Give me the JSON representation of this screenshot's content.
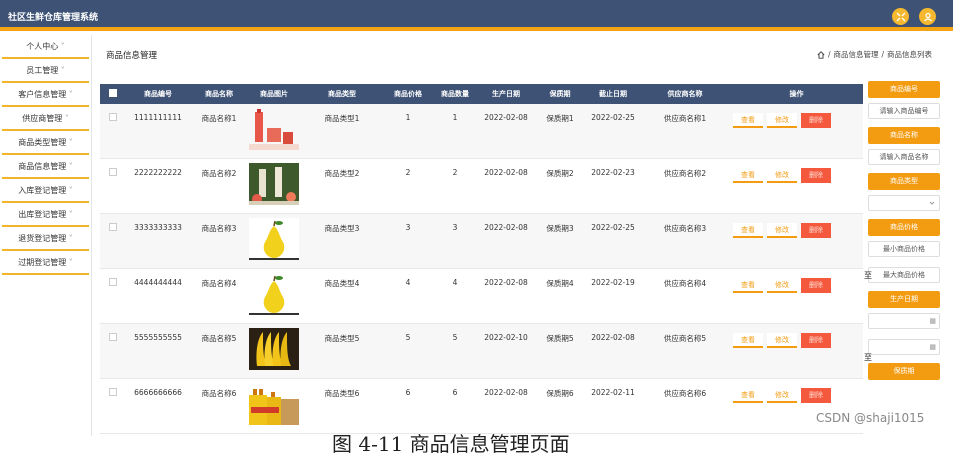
{
  "app": {
    "title": "社区生鲜仓库管理系统"
  },
  "sidebar": {
    "items": [
      {
        "label": "个人中心"
      },
      {
        "label": "员工管理"
      },
      {
        "label": "客户信息管理"
      },
      {
        "label": "供应商管理"
      },
      {
        "label": "商品类型管理"
      },
      {
        "label": "商品信息管理"
      },
      {
        "label": "入库登记管理"
      },
      {
        "label": "出库登记管理"
      },
      {
        "label": "退货登记管理"
      },
      {
        "label": "过期登记管理"
      }
    ]
  },
  "page": {
    "title": "商品信息管理",
    "breadcrumb": [
      "商品信息管理",
      "商品信息列表"
    ]
  },
  "table": {
    "headers": [
      "商品编号",
      "商品名称",
      "商品图片",
      "商品类型",
      "商品价格",
      "商品数量",
      "生产日期",
      "保质期",
      "截止日期",
      "供应商名称",
      "操作"
    ],
    "rows": [
      {
        "id": "1111111111",
        "name": "商品名称1",
        "type": "商品类型1",
        "price": "1",
        "qty": "1",
        "prod": "2022-02-08",
        "shelf": "保质期1",
        "end": "2022-02-25",
        "supplier": "供应商名称1",
        "img": "bottle"
      },
      {
        "id": "2222222222",
        "name": "商品名称2",
        "type": "商品类型2",
        "price": "2",
        "qty": "2",
        "prod": "2022-02-08",
        "shelf": "保质期2",
        "end": "2022-02-23",
        "supplier": "供应商名称2",
        "img": "drinks"
      },
      {
        "id": "3333333333",
        "name": "商品名称3",
        "type": "商品类型3",
        "price": "3",
        "qty": "3",
        "prod": "2022-02-08",
        "shelf": "保质期3",
        "end": "2022-02-25",
        "supplier": "供应商名称3",
        "img": "pear"
      },
      {
        "id": "4444444444",
        "name": "商品名称4",
        "type": "商品类型4",
        "price": "4",
        "qty": "4",
        "prod": "2022-02-08",
        "shelf": "保质期4",
        "end": "2022-02-19",
        "supplier": "供应商名称4",
        "img": "pear"
      },
      {
        "id": "5555555555",
        "name": "商品名称5",
        "type": "商品类型5",
        "price": "5",
        "qty": "5",
        "prod": "2022-02-10",
        "shelf": "保质期5",
        "end": "2022-02-08",
        "supplier": "供应商名称5",
        "img": "banana"
      },
      {
        "id": "6666666666",
        "name": "商品名称6",
        "type": "商品类型6",
        "price": "6",
        "qty": "6",
        "prod": "2022-02-08",
        "shelf": "保质期6",
        "end": "2022-02-11",
        "supplier": "供应商名称6",
        "img": "oil"
      }
    ],
    "actions": {
      "view": "查看",
      "edit": "修改",
      "delete": "删除"
    }
  },
  "filters": {
    "code_btn": "商品编号",
    "code_ph": "请输入商品编号",
    "name_btn": "商品名称",
    "name_ph": "请输入商品名称",
    "type_btn": "商品类型",
    "price_btn": "商品价格",
    "min_ph": "最小商品价格",
    "max_ph": "最大商品价格",
    "to": "至",
    "date_btn": "生产日期",
    "shelf_btn": "保质期"
  },
  "caption": "图 4-11 商品信息管理页面",
  "watermark": "CSDN @shaji1015"
}
